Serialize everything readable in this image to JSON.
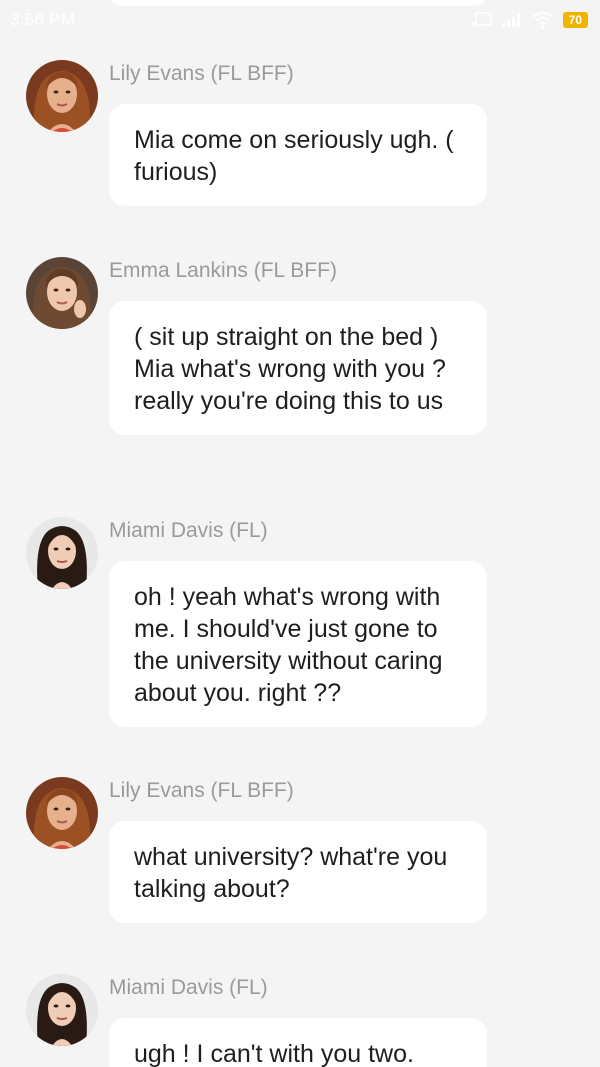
{
  "status_bar": {
    "time": "3:56 PM",
    "battery": "70"
  },
  "messages": [
    {
      "sender": "Lily Evans (FL BFF)",
      "avatar": "lily-evans-avatar",
      "text": "Mia come on seriously ugh. ( furious)"
    },
    {
      "sender": "Emma Lankins (FL BFF)",
      "avatar": "emma-lankins-avatar",
      "text": "( sit up straight on the bed ) Mia what's wrong with you ? really you're doing this to us"
    },
    {
      "sender": "Miami Davis (FL)",
      "avatar": "miami-davis-avatar",
      "text": "oh ! yeah what's wrong with me. I should've just gone to the university without caring about you. right ??"
    },
    {
      "sender": "Lily Evans (FL BFF)",
      "avatar": "lily-evans-avatar",
      "text": "what university? what're you talking about?"
    },
    {
      "sender": "Miami Davis (FL)",
      "avatar": "miami-davis-avatar",
      "text": "ugh ! I can't with you two."
    }
  ]
}
